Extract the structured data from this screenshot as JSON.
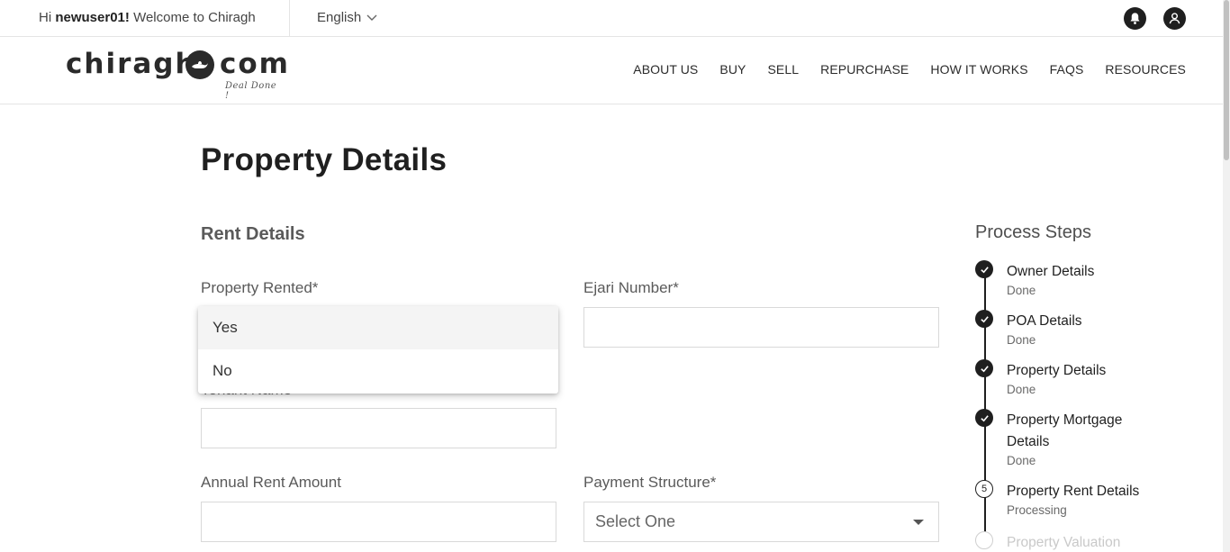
{
  "topbar": {
    "greeting_prefix": "Hi",
    "username": "newuser01!",
    "greeting_suffix": "Welcome to Chiragh",
    "language": "English",
    "icons": [
      "bell-icon",
      "user-icon"
    ]
  },
  "header": {
    "logo_left": "chiragh",
    "logo_right": "com",
    "logo_tagline": "Deal Done !",
    "nav": [
      "ABOUT US",
      "BUY",
      "SELL",
      "REPURCHASE",
      "HOW IT WORKS",
      "FAQS",
      "RESOURCES"
    ]
  },
  "main": {
    "page_title": "Property Details",
    "section_title": "Rent Details",
    "property_rented": {
      "label": "Property Rented*",
      "options": [
        "Yes",
        "No"
      ],
      "highlighted": "Yes"
    },
    "ejari_number": {
      "label": "Ejari Number*",
      "value": ""
    },
    "tenant_name": {
      "label": "Tenant Name",
      "value": ""
    },
    "annual_rent": {
      "label": "Annual Rent Amount",
      "value": ""
    },
    "payment_structure": {
      "label": "Payment Structure*",
      "placeholder": "Select One"
    }
  },
  "process": {
    "title": "Process Steps",
    "steps": [
      {
        "name": "Owner Details",
        "status": "Done",
        "state": "done"
      },
      {
        "name": "POA Details",
        "status": "Done",
        "state": "done"
      },
      {
        "name": "Property Details",
        "status": "Done",
        "state": "done"
      },
      {
        "name": "Property Mortgage Details",
        "status": "Done",
        "state": "done"
      },
      {
        "name": "Property Rent Details",
        "status": "Processing",
        "state": "current",
        "number": "5"
      },
      {
        "name": "Property Valuation",
        "status": "",
        "state": "pending"
      }
    ]
  },
  "colors": {
    "text_dark": "#1f1f1f",
    "text_muted": "#5a5a5a",
    "border": "#d9d9d9",
    "pending": "#c9c9c9"
  }
}
